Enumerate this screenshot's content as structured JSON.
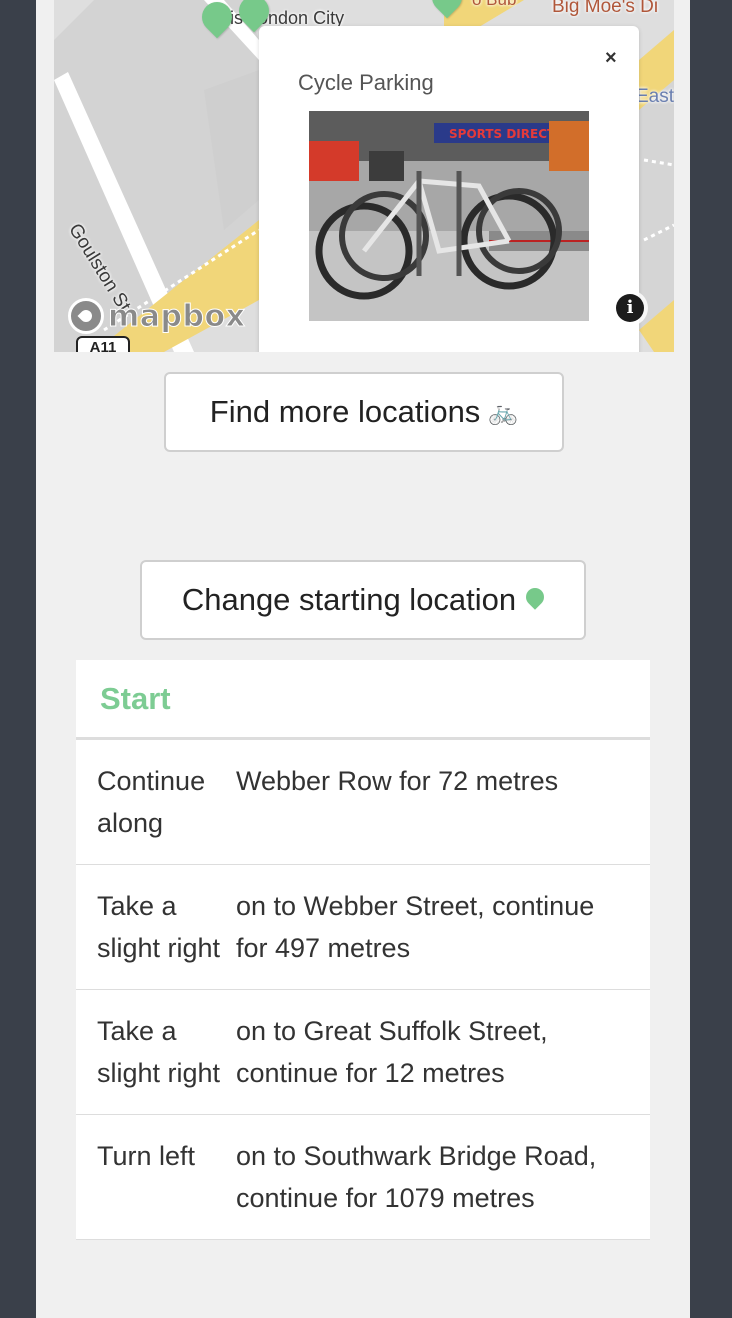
{
  "map": {
    "labels": {
      "goulston": "Goulston St",
      "london_city": "is London City",
      "big_moes": "Big Moe's Di",
      "east": "East",
      "bub": "o Bub"
    },
    "road_shield": "A11",
    "logo_text": "mapbox",
    "info_icon": "info-icon",
    "pin_color": "#77c98a"
  },
  "popup": {
    "title": "Cycle Parking",
    "close": "×",
    "photo_text": "SPORTS DIRECT"
  },
  "buttons": {
    "find_more": "Find more locations",
    "find_more_emoji": "🚲",
    "change_start": "Change starting location"
  },
  "directions": {
    "header": "Start",
    "accent": "#7dcc93",
    "steps": [
      {
        "action": "Continue along",
        "detail": "Webber Row for 72 metres"
      },
      {
        "action": "Take a slight right",
        "detail": "on to Webber Street, continue for 497 metres"
      },
      {
        "action": "Take a slight right",
        "detail": "on to Great Suffolk Street, continue for 12 metres"
      },
      {
        "action": "Turn left",
        "detail": "on to Southwark Bridge Road, continue for 1079 metres"
      }
    ]
  }
}
